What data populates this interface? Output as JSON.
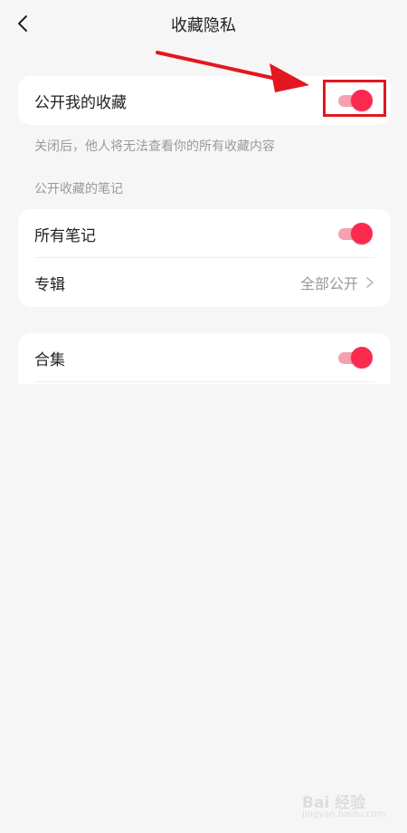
{
  "header": {
    "title": "收藏隐私",
    "back_icon": "chevron-left-icon"
  },
  "public_collection": {
    "label": "公开我的收藏",
    "enabled": true,
    "hint": "关闭后，他人将无法查看你的所有收藏内容"
  },
  "section_title": "公开收藏的笔记",
  "notes_card": {
    "all_notes": {
      "label": "所有笔记",
      "enabled": true
    },
    "albums": {
      "label": "专辑",
      "value": "全部公开"
    }
  },
  "collections": {
    "label": "合集",
    "enabled": true
  },
  "annotation": {
    "color": "#e2171f",
    "shape": "arrow-and-box"
  },
  "colors": {
    "accent": "#fb2a4f",
    "track": "#f7a0ae",
    "background": "#f6f6f6",
    "card": "#ffffff"
  },
  "watermark": {
    "brand": "Bai 经验",
    "sub": "jingyan.baidu.com"
  }
}
